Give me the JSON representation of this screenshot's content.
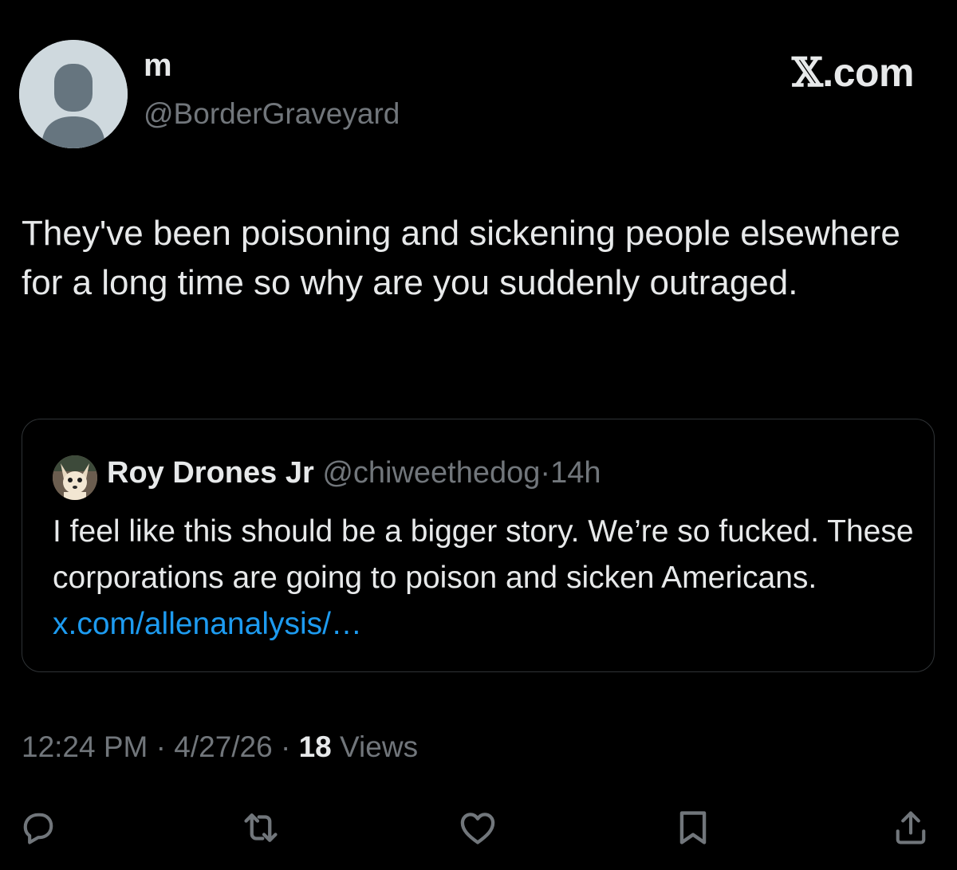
{
  "tweet": {
    "author": {
      "display_name": "m",
      "handle": "@BorderGraveyard",
      "avatar_icon": "default-profile-icon"
    },
    "brand": {
      "x_glyph": "𝕏",
      "suffix": ".com"
    },
    "text": "They've been poisoning and sickening people elsewhere for a long time so why are you suddenly outraged.",
    "quoted": {
      "display_name": "Roy Drones Jr",
      "handle": "@chiweethedog",
      "separator": "·",
      "time": "14h",
      "text": "I feel like this should be a bigger story. We’re so fucked. These corporations are going to poison and sicken Americans. ",
      "link": "x.com/allenanalysis/…",
      "avatar_icon": "chihuahua-avatar"
    },
    "meta": {
      "time": "12:24 PM",
      "sep1": " · ",
      "date": "4/27/26",
      "sep2": " · ",
      "views_count": "18",
      "views_label": " Views"
    },
    "actions": [
      {
        "name": "reply",
        "icon": "speech-bubble-icon"
      },
      {
        "name": "repost",
        "icon": "repost-arrows-icon"
      },
      {
        "name": "like",
        "icon": "heart-icon"
      },
      {
        "name": "bookmark",
        "icon": "bookmark-icon"
      },
      {
        "name": "share",
        "icon": "share-icon"
      }
    ]
  },
  "colors": {
    "background": "#000000",
    "primary_text": "#e7e9ea",
    "secondary_text": "#71767b",
    "link": "#1d9bf0",
    "border": "#2f3336"
  }
}
